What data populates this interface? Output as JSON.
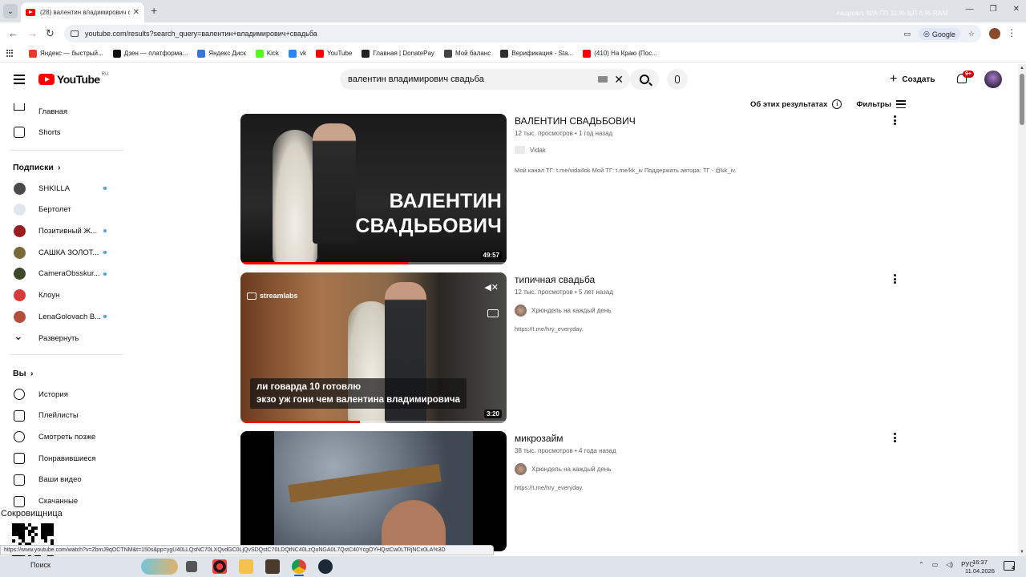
{
  "browser": {
    "tab_title": "(28) валентин владимирович с",
    "url": "youtube.com/results?search_query=валентин+владимирович+свадьба",
    "google_chip": "Google",
    "overlay_stats": "кадров/с  N/A    ГП  11 %    ЦП  6 %    RAM",
    "bookmarks": [
      {
        "label": "Яндекс — быстрый...",
        "color": "#e8392b"
      },
      {
        "label": "Дзен — платформа...",
        "color": "#111111"
      },
      {
        "label": "Яндекс Диск",
        "color": "#3b73d6"
      },
      {
        "label": "Kick",
        "color": "#53fc18"
      },
      {
        "label": "vk",
        "color": "#2787f5"
      },
      {
        "label": "YouTube",
        "color": "#ff0000"
      },
      {
        "label": "Главная | DonatePay",
        "color": "#222222"
      },
      {
        "label": "Мой баланс",
        "color": "#444444"
      },
      {
        "label": "Верификация - Sta...",
        "color": "#2f2f2f"
      },
      {
        "label": "(410) На Краю (Пос...",
        "color": "#ff0000"
      }
    ]
  },
  "masthead": {
    "logo": "YouTube",
    "country": "RU",
    "search_query": "валентин владимирович свадьба",
    "create_label": "Создать",
    "notifications_badge": "9+"
  },
  "sidebar": {
    "main": [
      {
        "label": "Главная",
        "icon": "home-icon"
      },
      {
        "label": "Shorts",
        "icon": "shorts-icon"
      }
    ],
    "subscriptions_heading": "Подписки",
    "subscriptions": [
      {
        "label": "SHKILLA",
        "color": "#4a4a4a",
        "live": true
      },
      {
        "label": "Бертолет",
        "color": "#dfe7ef",
        "live": false
      },
      {
        "label": "Позитивный Ж...",
        "color": "#9b1c1c",
        "live": true
      },
      {
        "label": "САШКА ЗОЛОТ...",
        "color": "#7a6a3a",
        "live": true
      },
      {
        "label": "CameraObsskur...",
        "color": "#3d4a2a",
        "live": true
      },
      {
        "label": "Клоун",
        "color": "#d73a3a",
        "live": false
      },
      {
        "label": "LenaGolovach B...",
        "color": "#b44d3a",
        "live": true
      }
    ],
    "expand_label": "Развернуть",
    "you_heading": "Вы",
    "you_items": [
      {
        "label": "История",
        "icon": "history-icon"
      },
      {
        "label": "Плейлисты",
        "icon": "playlists-icon"
      },
      {
        "label": "Смотреть позже",
        "icon": "watch-later-icon"
      },
      {
        "label": "Понравившиеся",
        "icon": "like-icon"
      },
      {
        "label": "Ваши видео",
        "icon": "your-videos-icon"
      },
      {
        "label": "Скачанные",
        "icon": "downloads-icon"
      }
    ]
  },
  "results_header": {
    "about_label": "Об этих результатах",
    "filters_label": "Фильтры"
  },
  "results": [
    {
      "title": "ВАЛЕНТИН СВАДЬБОВИЧ",
      "meta": "12 тыс. просмотров • 1 год назад",
      "channel": "Vidak",
      "description": "Мой канал ТГ: t.me/vida4ok Мой ТГ: t.me/kk_iv Поддержать автора: ТГ - @kk_iv.",
      "duration": "49:57",
      "thumb_text_line1": "ВАЛЕНТИН",
      "thumb_text_line2": "СВАДЬБОВИЧ",
      "watched_fraction": 0.63
    },
    {
      "title": "типичная свадьба",
      "meta": "12 тыс. просмотров • 5 лет назад",
      "channel": "Хрюндель на каждый день",
      "description": "https://t.me/hry_everyday.",
      "duration": "3:20",
      "watermark": "streamlabs",
      "caption_line1": "ли говарда 10 готовлю",
      "caption_line2": "экзо уж гони чем валентина владимировича",
      "watched_fraction": 0.45
    },
    {
      "title": "микрозайм",
      "meta": "38 тыс. просмотров • 4 года назад",
      "channel": "Хрюндель на каждый день",
      "description": "https://t.me/hry_everyday."
    }
  ],
  "overlay": {
    "treasury_label": "Сокровищница",
    "status_url": "https://www.youtube.com/watch?v=ZbmJ9qOCTNM&t=150s&pp=ygU40LLQsNC70LXQvdGC0LjQvSDQstC70LDQtNC40LzQuNGA0L7QstC40YcgOYHQstCw0LTRjNCx0LA%3D"
  },
  "taskbar": {
    "search_label": "Поиск",
    "lang": "РУС",
    "time": "16:37",
    "date": "11.04.2026",
    "notification_count": "4"
  }
}
